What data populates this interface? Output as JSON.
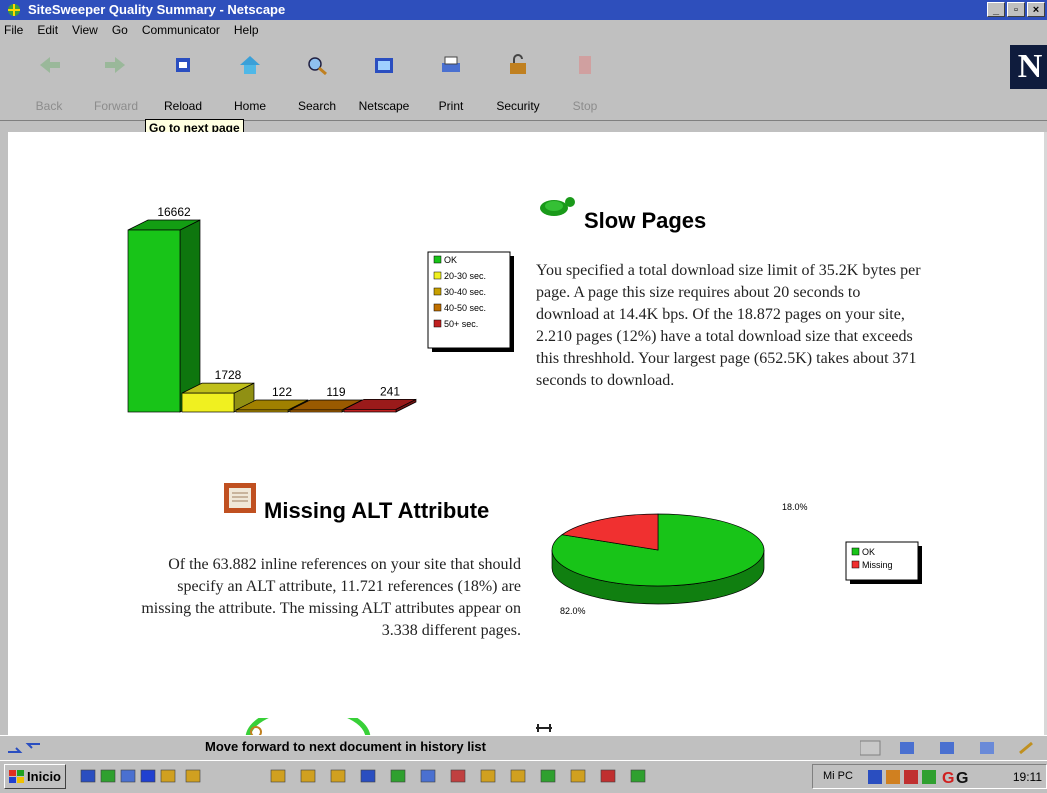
{
  "window": {
    "title": "SiteSweeper Quality Summary - Netscape"
  },
  "menu": [
    "File",
    "Edit",
    "View",
    "Go",
    "Communicator",
    "Help"
  ],
  "toolbar": {
    "buttons": [
      {
        "label": "Back",
        "icon": "back-arrow-icon",
        "enabled": false
      },
      {
        "label": "Forward",
        "icon": "forward-arrow-icon",
        "enabled": false
      },
      {
        "label": "Reload",
        "icon": "reload-icon",
        "enabled": true
      },
      {
        "label": "Home",
        "icon": "home-icon",
        "enabled": true
      },
      {
        "label": "Search",
        "icon": "search-icon",
        "enabled": true
      },
      {
        "label": "Netscape",
        "icon": "netscape-icon",
        "enabled": true
      },
      {
        "label": "Print",
        "icon": "print-icon",
        "enabled": true
      },
      {
        "label": "Security",
        "icon": "lock-icon",
        "enabled": true
      },
      {
        "label": "Stop",
        "icon": "stop-icon",
        "enabled": false
      }
    ],
    "logo": "N"
  },
  "tooltip": "Go to next page",
  "content": {
    "slow": {
      "heading": "Slow Pages",
      "text": "You specified a total download size limit of 35.2K bytes per page. A page this size requires about 20 seconds to download at 14.4K bps. Of the 18.872 pages on your site, 2.210 pages (12%) have a total download size that exceeds this threshhold. Your largest page (652.5K) takes about 371 seconds to download."
    },
    "alt": {
      "heading": "Missing ALT Attribute",
      "text": "Of the 63.882 inline references on your site that should specify an ALT attribute, 11.721 references (18%) are missing the attribute. The missing ALT attributes appear on 3.338 different pages."
    }
  },
  "chart_data": [
    {
      "type": "bar",
      "categories": [
        "OK",
        "20-30 sec.",
        "30-40 sec.",
        "40-50 sec.",
        "50+ sec."
      ],
      "values": [
        16662,
        1728,
        122,
        119,
        241
      ],
      "colors": [
        "#18c418",
        "#f0f020",
        "#c8a000",
        "#c07000",
        "#c02020"
      ],
      "legend_placement": "right"
    },
    {
      "type": "pie",
      "categories": [
        "OK",
        "Missing"
      ],
      "values": [
        82.0,
        18.0
      ],
      "labels": [
        "82.0%",
        "18.0%"
      ],
      "colors": [
        "#18c418",
        "#f03030"
      ],
      "legend_placement": "right"
    }
  ],
  "statusbar": {
    "text": "Move forward to next document in history list"
  },
  "taskbar": {
    "start": "Inicio",
    "tray_label": "Mi PC",
    "clock": "19:11"
  }
}
